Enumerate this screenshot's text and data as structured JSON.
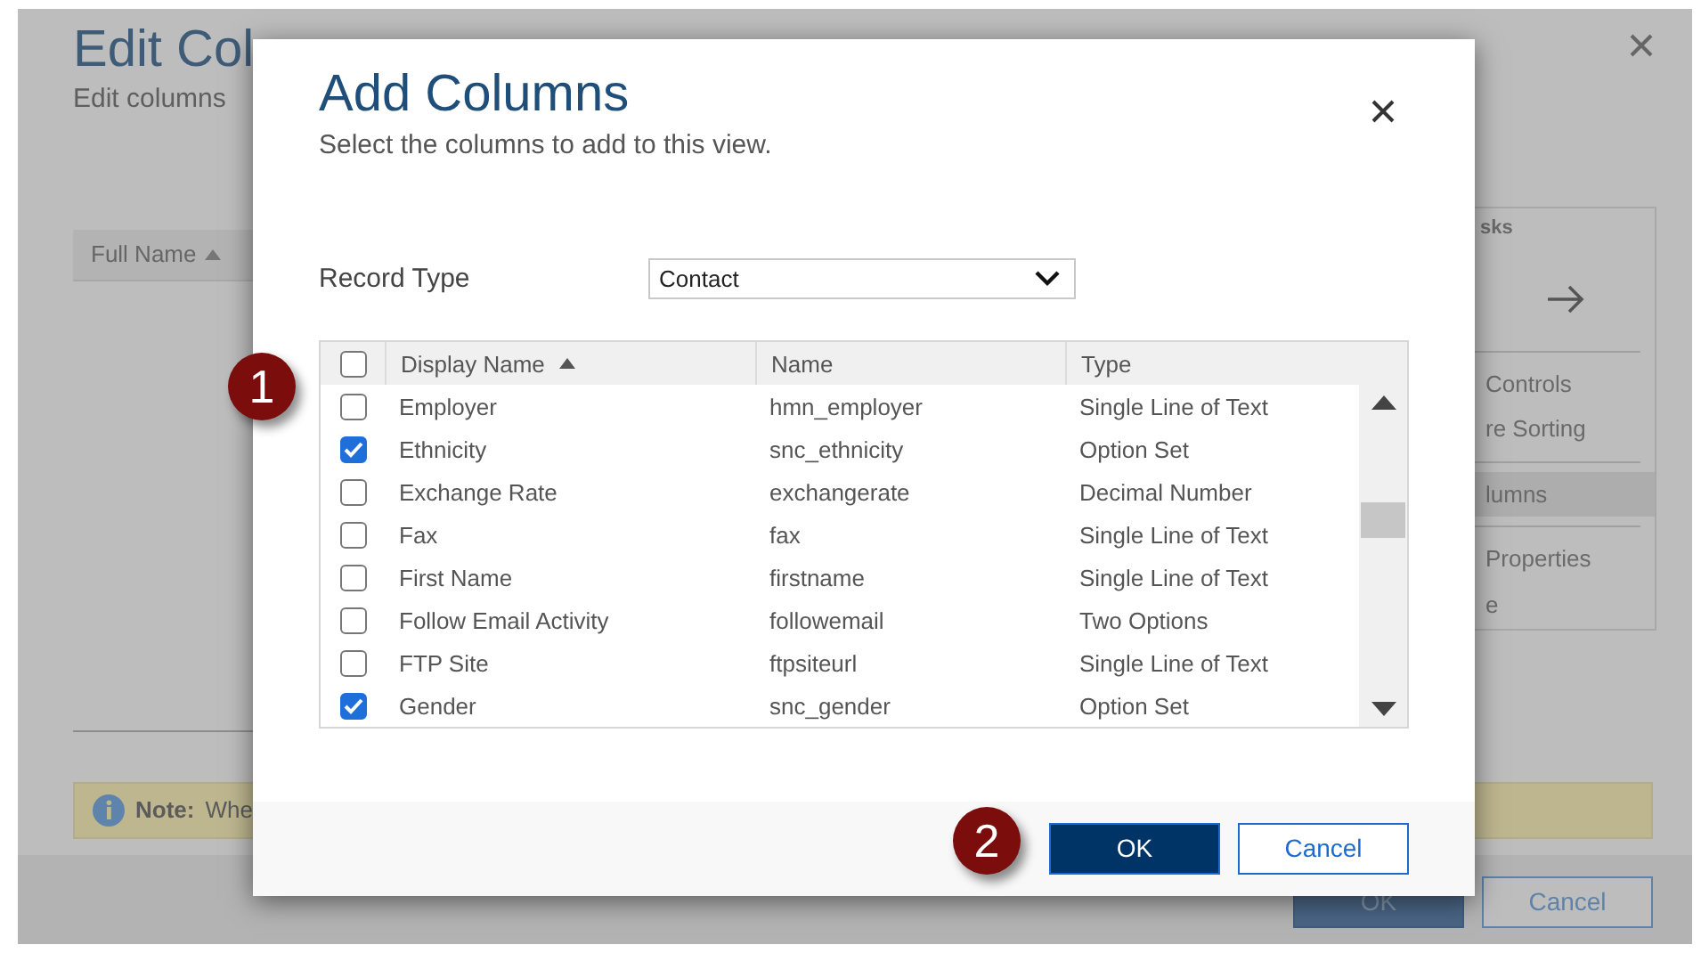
{
  "background": {
    "title": "Edit Col",
    "subtitle": "Edit columns",
    "column_header": {
      "label": "Full Name",
      "sorted": true
    },
    "side_panel": {
      "heading": "sks",
      "items": [
        {
          "label": "Controls",
          "selected": false
        },
        {
          "label": "re Sorting",
          "selected": false
        },
        {
          "label": "lumns",
          "selected": true
        },
        {
          "label": "Properties",
          "selected": false
        },
        {
          "label": "e",
          "selected": false
        }
      ]
    },
    "note": {
      "label": "Note:",
      "text": "Whe"
    },
    "buttons": [
      {
        "label": "OK",
        "kind": "primary"
      },
      {
        "label": "Cancel",
        "kind": "secondary"
      }
    ]
  },
  "dialog": {
    "title": "Add Columns",
    "subtitle": "Select the columns to add to this view.",
    "record_type": {
      "label": "Record Type",
      "value": "Contact"
    },
    "table": {
      "select_all_checked": false,
      "columns": [
        {
          "label": "Display Name",
          "sorted": true
        },
        {
          "label": "Name",
          "sorted": false
        },
        {
          "label": "Type",
          "sorted": false
        }
      ],
      "rows": [
        {
          "checked": false,
          "display_name": "Employer",
          "name": "hmn_employer",
          "type": "Single Line of Text"
        },
        {
          "checked": true,
          "display_name": "Ethnicity",
          "name": "snc_ethnicity",
          "type": "Option Set"
        },
        {
          "checked": false,
          "display_name": "Exchange Rate",
          "name": "exchangerate",
          "type": "Decimal Number"
        },
        {
          "checked": false,
          "display_name": "Fax",
          "name": "fax",
          "type": "Single Line of Text"
        },
        {
          "checked": false,
          "display_name": "First Name",
          "name": "firstname",
          "type": "Single Line of Text"
        },
        {
          "checked": false,
          "display_name": "Follow Email Activity",
          "name": "followemail",
          "type": "Two Options"
        },
        {
          "checked": false,
          "display_name": "FTP Site",
          "name": "ftpsiteurl",
          "type": "Single Line of Text"
        },
        {
          "checked": true,
          "display_name": "Gender",
          "name": "snc_gender",
          "type": "Option Set"
        }
      ]
    },
    "buttons": [
      {
        "label": "OK",
        "kind": "primary"
      },
      {
        "label": "Cancel",
        "kind": "secondary"
      }
    ]
  },
  "callouts": [
    "1",
    "2"
  ]
}
